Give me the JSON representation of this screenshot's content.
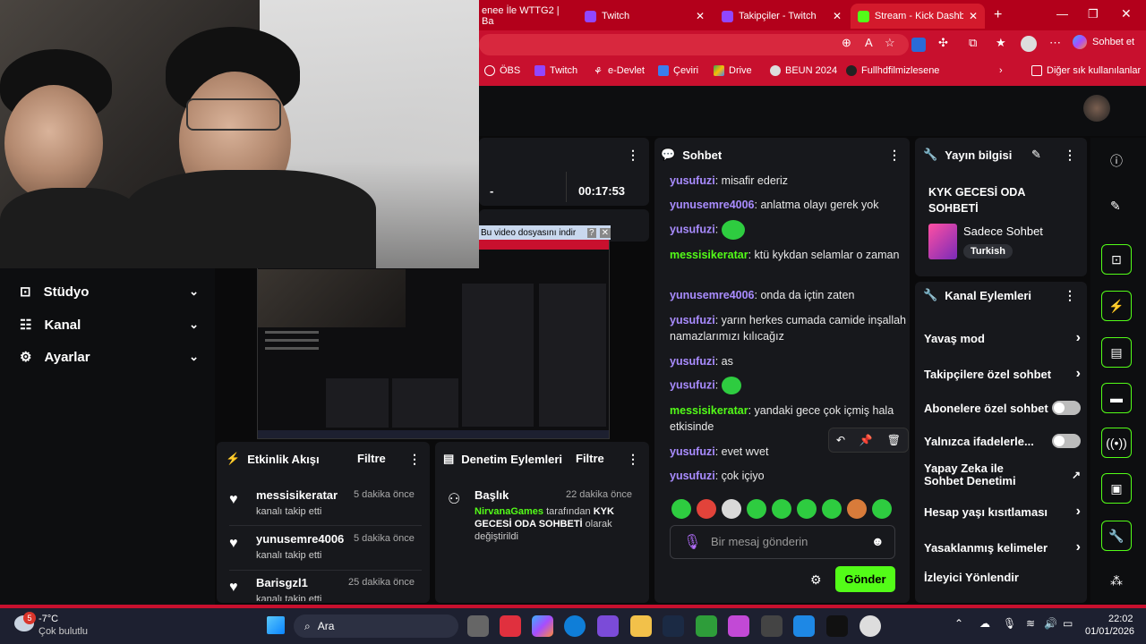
{
  "browser": {
    "tabs": [
      {
        "label": "enee İle WTTG2 | Ba",
        "active": false
      },
      {
        "label": "Twitch",
        "active": false
      },
      {
        "label": "Takipçiler - Twitch",
        "active": false
      },
      {
        "label": "Stream - Kick Dashboar",
        "active": true
      }
    ],
    "sohbet_et": "Sohbet et",
    "bookmarks": [
      "ÖBS",
      "Twitch",
      "e-Devlet",
      "Çeviri",
      "Drive",
      "BEUN 2024",
      "Fullhdfilmizlesene"
    ],
    "other_bookmarks": "Diğer sık kullanılanlar"
  },
  "sidebar": {
    "items": [
      {
        "label": "Stüdyo"
      },
      {
        "label": "Kanal"
      },
      {
        "label": "Ayarlar"
      }
    ]
  },
  "stream_panel": {
    "timer": "00:17:53",
    "dash": "-"
  },
  "download_popup": "Bu video dosyasını indir",
  "activity": {
    "title": "Etkinlik Akışı",
    "filter": "Filtre",
    "items": [
      {
        "user": "messisikeratar",
        "time": "5 dakika önce",
        "action": "kanalı takip etti"
      },
      {
        "user": "yunusemre4006",
        "time": "5 dakika önce",
        "action": "kanalı takip etti"
      },
      {
        "user": "Barisgzl1",
        "time": "25 dakika önce",
        "action": "kanalı takip etti"
      }
    ]
  },
  "moderation": {
    "title": "Denetim Eylemleri",
    "filter": "Filtre",
    "item": {
      "title": "Başlık",
      "time": "22 dakika önce",
      "actor": "NirvanaGames",
      "text1": " tarafından ",
      "bold": "KYK GECESİ ODA SOHBETİ",
      "text2": " olarak değiştirildi"
    }
  },
  "chat": {
    "title": "Sohbet",
    "messages": [
      {
        "user": "yusufuzi",
        "text": "misafir ederiz",
        "cls": "u1"
      },
      {
        "user": "yunusemre4006",
        "text": "anlatma olayı gerek yok",
        "cls": "u2"
      },
      {
        "user": "yusufuzi",
        "text": "",
        "emote": true,
        "cls": "u1"
      },
      {
        "user": "messisikeratar",
        "text": "ktü kykdan selamlar o zaman",
        "cls": "u3"
      },
      {
        "user": "yunusemre4006",
        "text": "onda da içtin zaten",
        "cls": "u2"
      },
      {
        "user": "yusufuzi",
        "text": "yarın herkes cumada camide inşallah namazlarımızı kılıcağız",
        "cls": "u1"
      },
      {
        "user": "yusufuzi",
        "text": "as",
        "cls": "u1"
      },
      {
        "user": "yusufuzi",
        "text": "",
        "emote": true,
        "cls": "u1"
      },
      {
        "user": "messisikeratar",
        "text": "yandaki gece çok içmiş hala etkisinde",
        "cls": "u3"
      },
      {
        "user": "yusufuzi",
        "text": "evet wvet",
        "cls": "u1"
      },
      {
        "user": "yusufuzi",
        "text": "çok içiyo",
        "cls": "u1"
      }
    ],
    "placeholder": "Bir mesaj gönderin",
    "send": "Gönder"
  },
  "stream_info": {
    "title": "Yayın bilgisi",
    "stream_title": "KYK GECESİ ODA SOHBETİ",
    "category": "Sadece Sohbet",
    "language": "Turkish"
  },
  "channel_actions": {
    "title": "Kanal Eylemleri",
    "items": [
      {
        "label": "Yavaş mod",
        "kind": "chevron"
      },
      {
        "label": "Takipçilere özel sohbet",
        "kind": "chevron"
      },
      {
        "label": "Abonelere özel sohbet",
        "kind": "toggle"
      },
      {
        "label": "Yalnızca ifadelerle...",
        "kind": "toggle"
      },
      {
        "label": "Yapay Zeka ile Sohbet Denetimi",
        "kind": "external"
      },
      {
        "label": "Hesap yaşı kısıtlaması",
        "kind": "chevron"
      },
      {
        "label": "Yasaklanmış kelimeler",
        "kind": "chevron"
      },
      {
        "label": "İzleyici Yönlendir",
        "kind": "none"
      }
    ]
  },
  "taskbar": {
    "weather_temp": "-7°C",
    "weather_desc": "Çok bulutlu",
    "weather_badge": "5",
    "search": "Ara",
    "time": "22:02",
    "date": "01/01/2026"
  },
  "colors": {
    "kick_green": "#53fc18",
    "chrome_red": "#c8102e",
    "panel": "#17181c"
  }
}
